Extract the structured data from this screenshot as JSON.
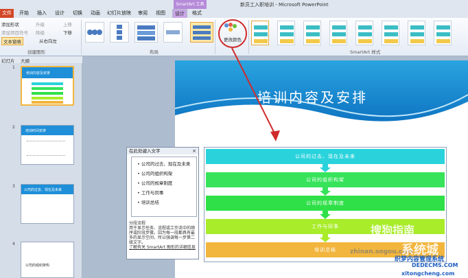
{
  "window": {
    "title": "新员工入职培训 - Microsoft PowerPoint",
    "ctx_tab": "SmartArt 工具"
  },
  "tabs": [
    "文件",
    "开始",
    "插入",
    "设计",
    "切换",
    "动画",
    "幻灯片放映",
    "审阅",
    "视图",
    "设计",
    "格式"
  ],
  "ribbon": {
    "create": {
      "add_shape": "添加形状",
      "add_bullet": "添加项目符号",
      "text_pane": "文本窗格",
      "promote": "升级",
      "demote": "降级",
      "move_up": "上移",
      "move_down": "下移",
      "rtl": "从右向左",
      "label": "创建图形"
    },
    "layout_label": "布局",
    "change_color": "更改颜色",
    "styles_label": "SmartArt 样式"
  },
  "panel": {
    "tab_slides": "幻灯片",
    "tab_outline": "大纲"
  },
  "thumbs": [
    {
      "num": "1",
      "title": "培训内容及安排"
    },
    {
      "num": "2",
      "title": "培训时间安排"
    },
    {
      "num": "3",
      "title": "公司的过去、现在及未来"
    },
    {
      "num": "4",
      "title": "公司的组织架构"
    }
  ],
  "slide": {
    "title": "培训内容及安排"
  },
  "smartart": {
    "items": [
      "公司的过去、现在及未来",
      "公司的组织构架",
      "公司的规章制度",
      "工作与同事",
      "培训总结"
    ],
    "colors": [
      "#2ad3dc",
      "#36e35a",
      "#2fe048",
      "#a8ec2a",
      "#f2b53d"
    ]
  },
  "text_pane": {
    "title": "在此处键入文字",
    "items": [
      "公司的过去、现在及未来",
      "公司的组织构架",
      "公司的规章制度",
      "工作与同事",
      "培训总结"
    ],
    "desc_title": "分段流程",
    "desc": "用于显示任务、流程或工作流中的顺序或阶段步骤。因为每一段都具有最多的显示空间，所以强调每一步第二级文字。",
    "learn_more": "了解有关 SmartArt 图形的详细信息"
  },
  "watermarks": [
    "搜狗指南",
    "zhinan.sogou.com",
    "系统城",
    "织梦内容管理系统",
    "DEDECMS.COM",
    "xitongcheng.com"
  ]
}
